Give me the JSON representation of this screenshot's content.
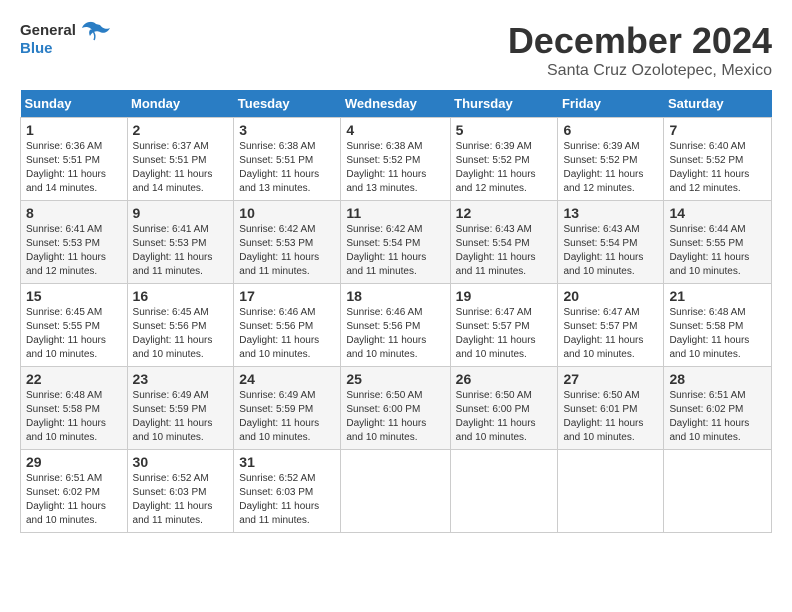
{
  "header": {
    "logo_general": "General",
    "logo_blue": "Blue",
    "month_title": "December 2024",
    "location": "Santa Cruz Ozolotepec, Mexico"
  },
  "calendar": {
    "days_of_week": [
      "Sunday",
      "Monday",
      "Tuesday",
      "Wednesday",
      "Thursday",
      "Friday",
      "Saturday"
    ],
    "weeks": [
      [
        null,
        null,
        null,
        null,
        null,
        null,
        null
      ]
    ],
    "cells": [
      {
        "date": 1,
        "col": 0,
        "sunrise": "6:36 AM",
        "sunset": "5:51 PM",
        "daylight": "11 hours and 14 minutes."
      },
      {
        "date": 2,
        "col": 1,
        "sunrise": "6:37 AM",
        "sunset": "5:51 PM",
        "daylight": "11 hours and 14 minutes."
      },
      {
        "date": 3,
        "col": 2,
        "sunrise": "6:38 AM",
        "sunset": "5:51 PM",
        "daylight": "11 hours and 13 minutes."
      },
      {
        "date": 4,
        "col": 3,
        "sunrise": "6:38 AM",
        "sunset": "5:52 PM",
        "daylight": "11 hours and 13 minutes."
      },
      {
        "date": 5,
        "col": 4,
        "sunrise": "6:39 AM",
        "sunset": "5:52 PM",
        "daylight": "11 hours and 12 minutes."
      },
      {
        "date": 6,
        "col": 5,
        "sunrise": "6:39 AM",
        "sunset": "5:52 PM",
        "daylight": "11 hours and 12 minutes."
      },
      {
        "date": 7,
        "col": 6,
        "sunrise": "6:40 AM",
        "sunset": "5:52 PM",
        "daylight": "11 hours and 12 minutes."
      },
      {
        "date": 8,
        "col": 0,
        "sunrise": "6:41 AM",
        "sunset": "5:53 PM",
        "daylight": "11 hours and 12 minutes."
      },
      {
        "date": 9,
        "col": 1,
        "sunrise": "6:41 AM",
        "sunset": "5:53 PM",
        "daylight": "11 hours and 11 minutes."
      },
      {
        "date": 10,
        "col": 2,
        "sunrise": "6:42 AM",
        "sunset": "5:53 PM",
        "daylight": "11 hours and 11 minutes."
      },
      {
        "date": 11,
        "col": 3,
        "sunrise": "6:42 AM",
        "sunset": "5:54 PM",
        "daylight": "11 hours and 11 minutes."
      },
      {
        "date": 12,
        "col": 4,
        "sunrise": "6:43 AM",
        "sunset": "5:54 PM",
        "daylight": "11 hours and 11 minutes."
      },
      {
        "date": 13,
        "col": 5,
        "sunrise": "6:43 AM",
        "sunset": "5:54 PM",
        "daylight": "11 hours and 10 minutes."
      },
      {
        "date": 14,
        "col": 6,
        "sunrise": "6:44 AM",
        "sunset": "5:55 PM",
        "daylight": "11 hours and 10 minutes."
      },
      {
        "date": 15,
        "col": 0,
        "sunrise": "6:45 AM",
        "sunset": "5:55 PM",
        "daylight": "11 hours and 10 minutes."
      },
      {
        "date": 16,
        "col": 1,
        "sunrise": "6:45 AM",
        "sunset": "5:56 PM",
        "daylight": "11 hours and 10 minutes."
      },
      {
        "date": 17,
        "col": 2,
        "sunrise": "6:46 AM",
        "sunset": "5:56 PM",
        "daylight": "11 hours and 10 minutes."
      },
      {
        "date": 18,
        "col": 3,
        "sunrise": "6:46 AM",
        "sunset": "5:56 PM",
        "daylight": "11 hours and 10 minutes."
      },
      {
        "date": 19,
        "col": 4,
        "sunrise": "6:47 AM",
        "sunset": "5:57 PM",
        "daylight": "11 hours and 10 minutes."
      },
      {
        "date": 20,
        "col": 5,
        "sunrise": "6:47 AM",
        "sunset": "5:57 PM",
        "daylight": "11 hours and 10 minutes."
      },
      {
        "date": 21,
        "col": 6,
        "sunrise": "6:48 AM",
        "sunset": "5:58 PM",
        "daylight": "11 hours and 10 minutes."
      },
      {
        "date": 22,
        "col": 0,
        "sunrise": "6:48 AM",
        "sunset": "5:58 PM",
        "daylight": "11 hours and 10 minutes."
      },
      {
        "date": 23,
        "col": 1,
        "sunrise": "6:49 AM",
        "sunset": "5:59 PM",
        "daylight": "11 hours and 10 minutes."
      },
      {
        "date": 24,
        "col": 2,
        "sunrise": "6:49 AM",
        "sunset": "5:59 PM",
        "daylight": "11 hours and 10 minutes."
      },
      {
        "date": 25,
        "col": 3,
        "sunrise": "6:50 AM",
        "sunset": "6:00 PM",
        "daylight": "11 hours and 10 minutes."
      },
      {
        "date": 26,
        "col": 4,
        "sunrise": "6:50 AM",
        "sunset": "6:00 PM",
        "daylight": "11 hours and 10 minutes."
      },
      {
        "date": 27,
        "col": 5,
        "sunrise": "6:50 AM",
        "sunset": "6:01 PM",
        "daylight": "11 hours and 10 minutes."
      },
      {
        "date": 28,
        "col": 6,
        "sunrise": "6:51 AM",
        "sunset": "6:02 PM",
        "daylight": "11 hours and 10 minutes."
      },
      {
        "date": 29,
        "col": 0,
        "sunrise": "6:51 AM",
        "sunset": "6:02 PM",
        "daylight": "11 hours and 10 minutes."
      },
      {
        "date": 30,
        "col": 1,
        "sunrise": "6:52 AM",
        "sunset": "6:03 PM",
        "daylight": "11 hours and 11 minutes."
      },
      {
        "date": 31,
        "col": 2,
        "sunrise": "6:52 AM",
        "sunset": "6:03 PM",
        "daylight": "11 hours and 11 minutes."
      }
    ]
  }
}
